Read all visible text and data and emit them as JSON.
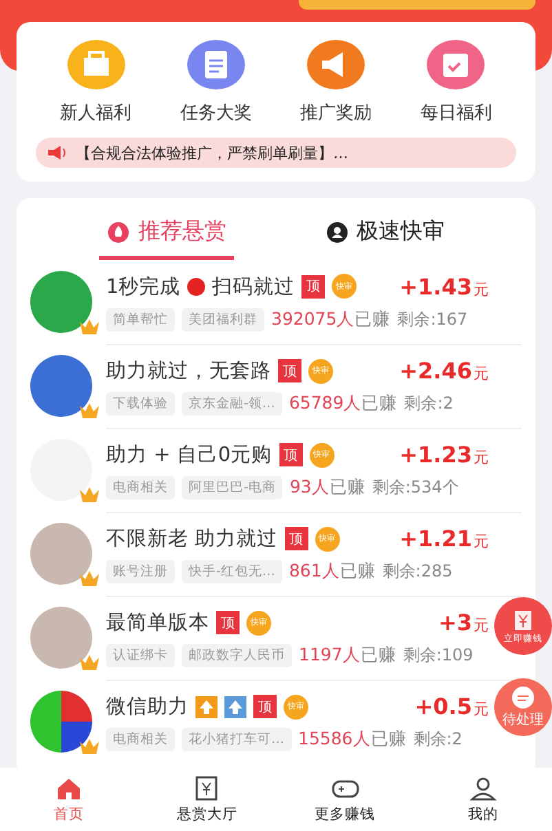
{
  "shortcuts": [
    {
      "label": "新人福利",
      "kind": "basket"
    },
    {
      "label": "任务大奖",
      "kind": "clipboard"
    },
    {
      "label": "推广奖励",
      "kind": "megaphone"
    },
    {
      "label": "每日福利",
      "kind": "calendar"
    }
  ],
  "notice": "【合规合法体验推广，严禁刷单刷量】…",
  "tabs": [
    {
      "label": "推荐悬赏",
      "selected": true
    },
    {
      "label": "极速快审",
      "selected": false
    }
  ],
  "tasks": [
    {
      "kind": "logo",
      "title": [
        {
          "kind": "text",
          "text": "1秒完成"
        },
        {
          "kind": "dot"
        },
        {
          "kind": "text",
          "text": "扫码就过"
        }
      ],
      "top_badge": "顶",
      "fast_badge": "快审",
      "tags": [
        "简单帮忙",
        "美团福利群"
      ],
      "earned": "392075人",
      "earned_suffix": "已赚",
      "remaining": "剩余:167",
      "price": "+1.43",
      "unit": "元"
    },
    {
      "kind": "letter",
      "title": [
        {
          "kind": "text",
          "text": "助力就过，无套路"
        }
      ],
      "top_badge": "顶",
      "fast_badge": "快审",
      "tags": [
        "下载体验",
        "京东金融-领…"
      ],
      "earned": "65789人",
      "earned_suffix": "已赚",
      "remaining": "剩余:2",
      "price": "+2.46",
      "unit": "元"
    },
    {
      "kind": "cartoon",
      "title": [
        {
          "kind": "text",
          "text": "助力 + 自己0元购"
        }
      ],
      "top_badge": "顶",
      "fast_badge": "快审",
      "tags": [
        "电商相关",
        "阿里巴巴-电商"
      ],
      "earned": "93人",
      "earned_suffix": "已赚",
      "remaining": "剩余:534个",
      "price": "+1.23",
      "unit": "元"
    },
    {
      "kind": "photo",
      "title": [
        {
          "kind": "text",
          "text": "不限新老 助力就过"
        }
      ],
      "top_badge": "顶",
      "fast_badge": "快审",
      "tags": [
        "账号注册",
        "快手-红包无…"
      ],
      "earned": "861人",
      "earned_suffix": "已赚",
      "remaining": "剩余:285",
      "price": "+1.21",
      "unit": "元"
    },
    {
      "kind": "photo",
      "title": [
        {
          "kind": "text",
          "text": "最简单版本"
        }
      ],
      "top_badge": "顶",
      "fast_badge": "快审",
      "tags": [
        "认证绑卡",
        "邮政数字人民币"
      ],
      "earned": "1197人",
      "earned_suffix": "已赚",
      "remaining": "剩余:109",
      "price": "+3",
      "unit": "元"
    },
    {
      "kind": "colorful",
      "title": [
        {
          "kind": "text",
          "text": "微信助力"
        },
        {
          "kind": "orange-arrow"
        },
        {
          "kind": "blue-arrow"
        }
      ],
      "top_badge": "顶",
      "fast_badge": "快审",
      "tags": [
        "电商相关",
        "花小猪打车可…"
      ],
      "earned": "15586人",
      "earned_suffix": "已赚",
      "remaining": "剩余:2",
      "price": "+0.5",
      "unit": "元"
    }
  ],
  "floating": [
    {
      "label": "立即赚钱",
      "kind": "money"
    },
    {
      "label": "待处理",
      "kind": "chat"
    }
  ],
  "nav": [
    {
      "label": "首页",
      "kind": "home",
      "selected": true
    },
    {
      "label": "悬赏大厅",
      "kind": "yen",
      "selected": false
    },
    {
      "label": "更多赚钱",
      "kind": "gamepad",
      "selected": false
    },
    {
      "label": "我的",
      "kind": "person",
      "selected": false
    }
  ]
}
